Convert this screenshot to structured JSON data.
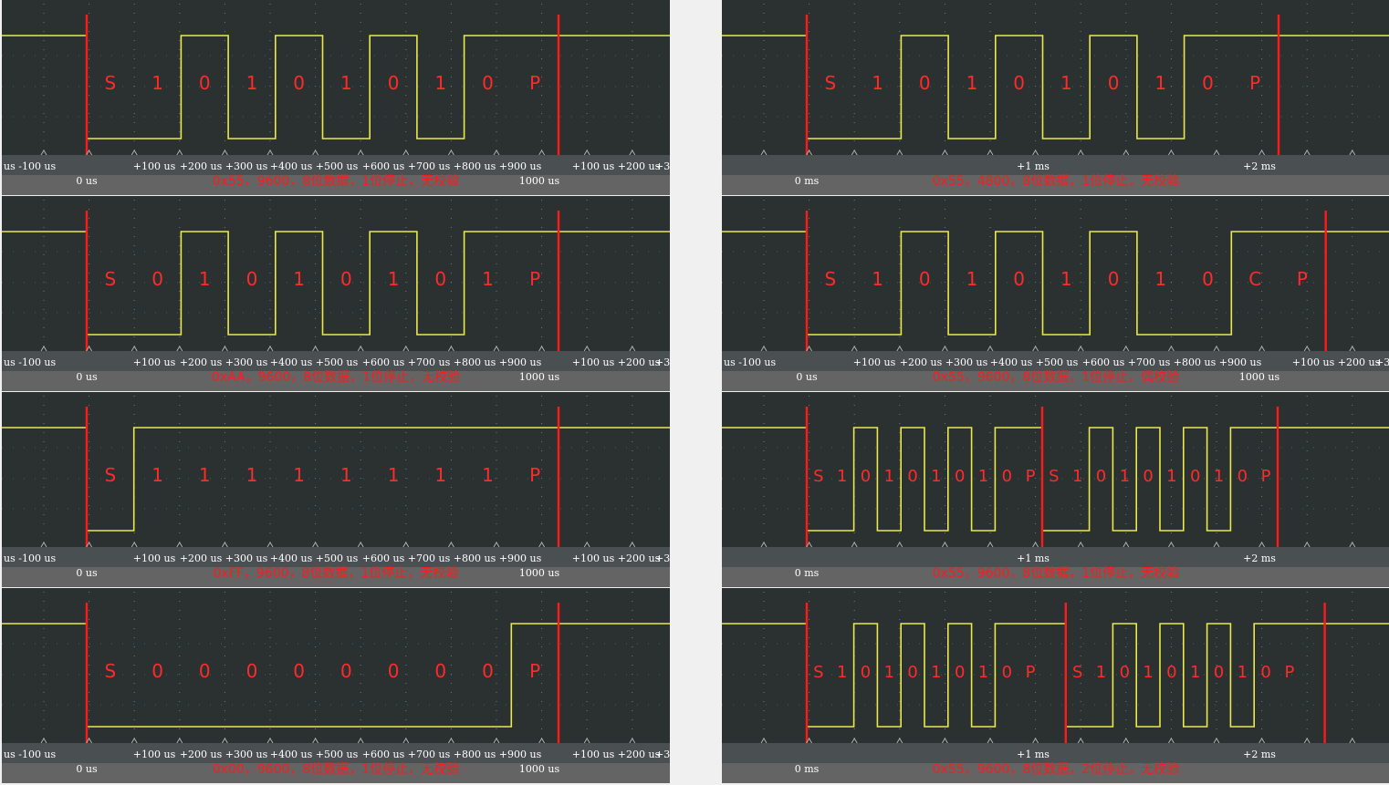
{
  "panels": [
    {
      "id": "l1",
      "column": "left",
      "row": 0,
      "caption": "0x55，9600，8位数据，1位停止，无校验",
      "bits": [
        "S",
        "1",
        "0",
        "1",
        "0",
        "1",
        "0",
        "1",
        "0",
        "P"
      ],
      "levels": [
        1,
        0,
        1,
        0,
        1,
        0,
        1,
        0,
        1,
        1
      ],
      "frames": 1,
      "scale": "us",
      "axis_top": [
        "us  -100 us",
        "+100 us",
        "+200 us",
        "+300 us",
        "+400 us",
        "+500 us",
        "+600 us",
        "+700 us",
        "+800 us",
        "+900 us",
        "+100 us",
        "+200 us",
        "+3"
      ],
      "axis_bottom": [
        "0 us",
        "1000 us"
      ]
    },
    {
      "id": "l2",
      "column": "left",
      "row": 1,
      "caption": "0xAA，9600，8位数据，1位停止，无校验",
      "bits": [
        "S",
        "0",
        "1",
        "0",
        "1",
        "0",
        "1",
        "0",
        "1",
        "P"
      ],
      "levels": [
        0,
        0,
        1,
        0,
        1,
        0,
        1,
        0,
        1,
        1
      ],
      "frames": 1,
      "scale": "us",
      "axis_top": [
        "us  -100 us",
        "+100 us",
        "+200 us",
        "+300 us",
        "+400 us",
        "+500 us",
        "+600 us",
        "+700 us",
        "+800 us",
        "+900 us",
        "+100 us",
        "+200 us",
        "+3"
      ],
      "axis_bottom": [
        "0 us",
        "1000 us"
      ]
    },
    {
      "id": "l3",
      "column": "left",
      "row": 2,
      "caption": "0xFF，9600，8位数据，1位停止，无校验",
      "bits": [
        "S",
        "1",
        "1",
        "1",
        "1",
        "1",
        "1",
        "1",
        "1",
        "P"
      ],
      "levels": [
        1,
        1,
        1,
        1,
        1,
        1,
        1,
        1,
        1,
        1
      ],
      "frames": 1,
      "scale": "us",
      "axis_top": [
        "us  -100 us",
        "+100 us",
        "+200 us",
        "+300 us",
        "+400 us",
        "+500 us",
        "+600 us",
        "+700 us",
        "+800 us",
        "+900 us",
        "+100 us",
        "+200 us",
        "+3"
      ],
      "axis_bottom": [
        "0 us",
        "1000 us"
      ]
    },
    {
      "id": "l4",
      "column": "left",
      "row": 3,
      "caption": "0x00，9600，8位数据，1位停止，无校验",
      "bits": [
        "S",
        "0",
        "0",
        "0",
        "0",
        "0",
        "0",
        "0",
        "0",
        "P"
      ],
      "levels": [
        0,
        0,
        0,
        0,
        0,
        0,
        0,
        0,
        0,
        1
      ],
      "frames": 1,
      "scale": "us",
      "axis_top": [
        "us  -100 us",
        "+100 us",
        "+200 us",
        "+300 us",
        "+400 us",
        "+500 us",
        "+600 us",
        "+700 us",
        "+800 us",
        "+900 us",
        "+100 us",
        "+200 us",
        "+3"
      ],
      "axis_bottom": [
        "0 us",
        "1000 us"
      ]
    },
    {
      "id": "r1",
      "column": "right",
      "row": 0,
      "caption": "0x55，4800，8位数据，1位停止，无校验",
      "bits": [
        "S",
        "1",
        "0",
        "1",
        "0",
        "1",
        "0",
        "1",
        "0",
        "P"
      ],
      "levels": [
        1,
        0,
        1,
        0,
        1,
        0,
        1,
        0,
        1,
        1
      ],
      "frames": 1,
      "scale": "ms",
      "axis_top": [
        "+1 ms",
        "+2 ms"
      ],
      "axis_bottom": [
        "0 ms"
      ]
    },
    {
      "id": "r2",
      "column": "right",
      "row": 1,
      "caption": "0x55，9600，8位数据，1位停止，偶校验",
      "bits": [
        "S",
        "1",
        "0",
        "1",
        "0",
        "1",
        "0",
        "1",
        "0",
        "C",
        "P"
      ],
      "levels": [
        1,
        0,
        1,
        0,
        1,
        0,
        1,
        0,
        0,
        1,
        1
      ],
      "frames": 1,
      "scale": "us",
      "axis_top": [
        "us  -100 us",
        "+100 us",
        "+200 us",
        "+300 us",
        "+400 us",
        "+500 us",
        "+600 us",
        "+700 us",
        "+800 us",
        "+900 us",
        "+100 us",
        "+200 us",
        "+3"
      ],
      "axis_bottom": [
        "0 us",
        "1000 us"
      ]
    },
    {
      "id": "r3",
      "column": "right",
      "row": 2,
      "caption": "0x55，9600，8位数据，1位停止，无校验",
      "bits": [
        "S",
        "1",
        "0",
        "1",
        "0",
        "1",
        "0",
        "1",
        "0",
        "P",
        "S",
        "1",
        "0",
        "1",
        "0",
        "1",
        "0",
        "1",
        "0",
        "P"
      ],
      "levels": [
        1,
        0,
        1,
        0,
        1,
        0,
        1,
        0,
        1,
        1
      ],
      "frames": 2,
      "scale": "ms",
      "axis_top": [
        "+1 ms",
        "+2 ms"
      ],
      "axis_bottom": [
        "0 ms"
      ]
    },
    {
      "id": "r4",
      "column": "right",
      "row": 3,
      "caption": "0x55，9600，8位数据，2位停止，无校验",
      "bits": [
        "S",
        "1",
        "0",
        "1",
        "0",
        "1",
        "0",
        "1",
        "0",
        "P",
        "S",
        "1",
        "0",
        "1",
        "0",
        "1",
        "0",
        "1",
        "0",
        "P"
      ],
      "levels": [
        1,
        0,
        1,
        0,
        1,
        0,
        1,
        0,
        1,
        1,
        1
      ],
      "frames": 2,
      "scale": "ms",
      "axis_top": [
        "+1 ms",
        "+2 ms"
      ],
      "axis_bottom": [
        "0 ms"
      ]
    }
  ],
  "colors": {
    "plot_bg": "#2b3031",
    "signal": "#e9e94a",
    "marker": "#ff1a1a",
    "bit_label": "#ff2a2a",
    "grid_dot": "#5e9e9a"
  }
}
